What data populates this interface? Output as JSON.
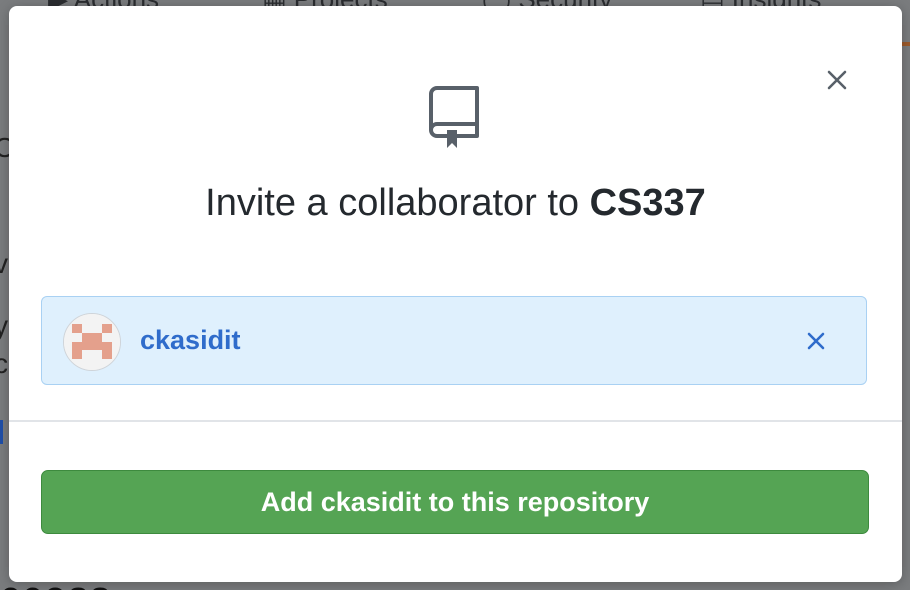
{
  "background": {
    "nav_items": [
      {
        "label": "Actions"
      },
      {
        "label": "Projects"
      },
      {
        "label": "Security"
      },
      {
        "label": "Insights"
      }
    ],
    "bottom_text": "ccess"
  },
  "modal": {
    "close_icon": "close-icon",
    "repo_icon": "repo-icon",
    "title_prefix": "Invite a collaborator to ",
    "repo_name": "CS337",
    "selected_user": {
      "username": "ckasidit",
      "avatar_icon": "identicon",
      "remove_icon": "close-icon"
    },
    "add_button_label": "Add ckasidit to this repository"
  },
  "colors": {
    "accent_blue": "#2f6ccb",
    "pill_bg": "#dff0fd",
    "button_green": "#55a454",
    "identicon": "#e4a08c"
  }
}
